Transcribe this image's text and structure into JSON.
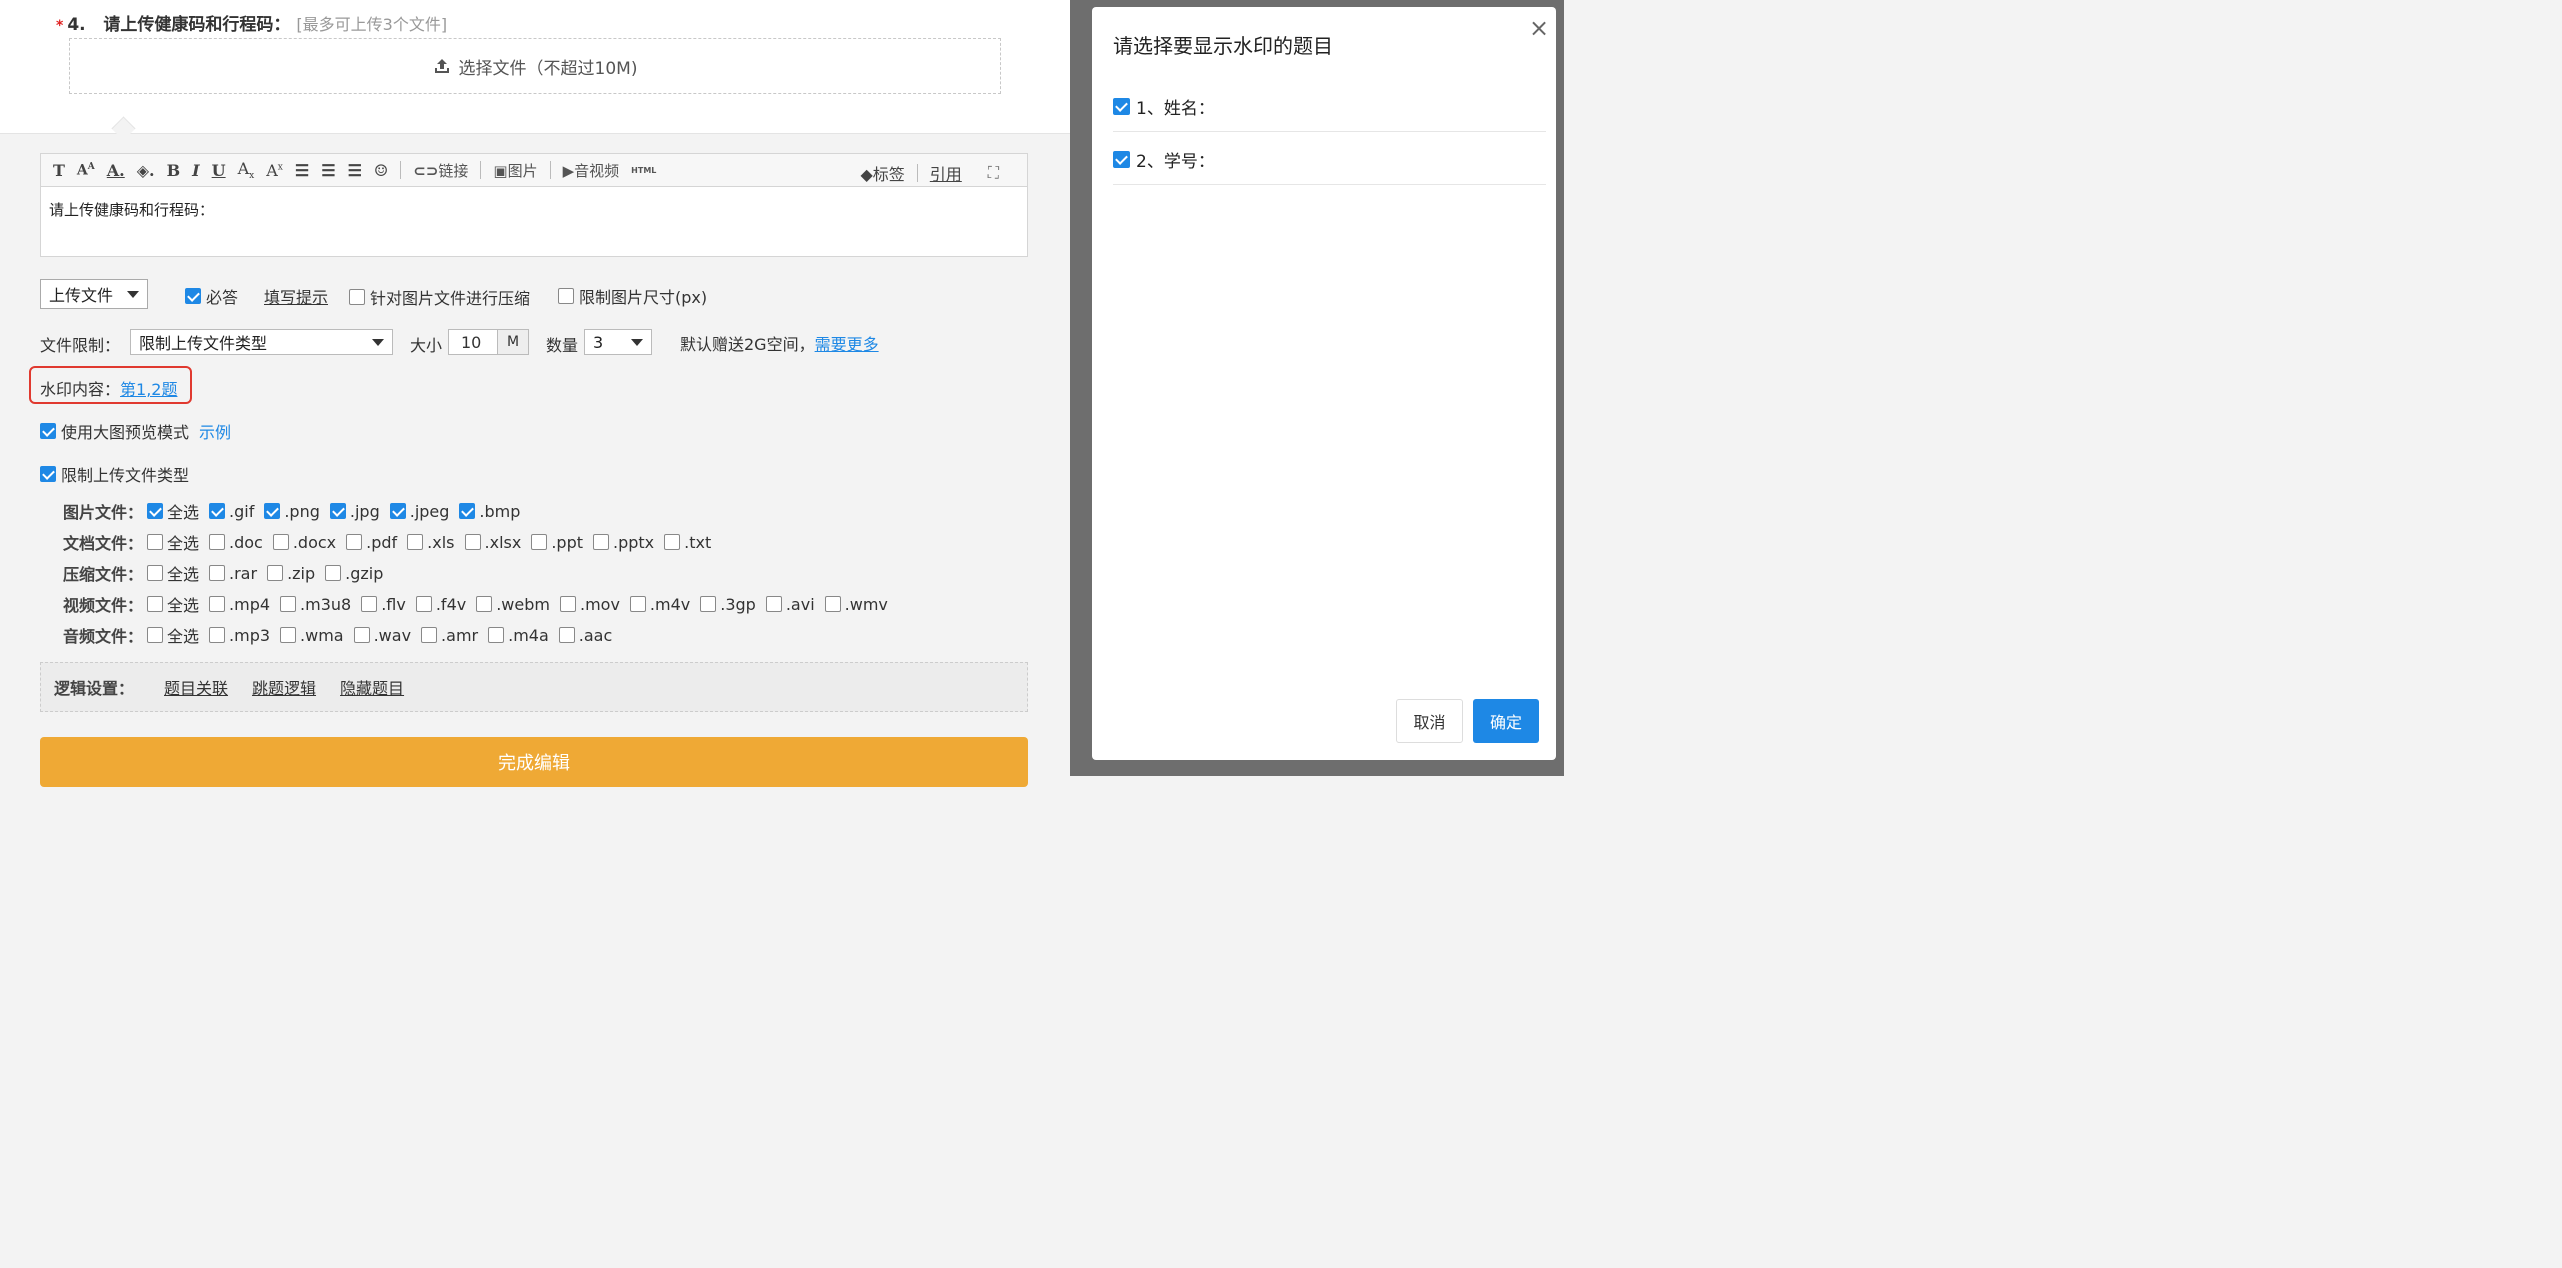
{
  "question": {
    "number": "4.",
    "title": "请上传健康码和行程码：",
    "hint": "[最多可上传3个文件]",
    "upload_label": "选择文件（不超过10M)"
  },
  "toolbar": {
    "link_label": "链接",
    "image_label": "图片",
    "av_label": "音视频",
    "html_label": "HTML",
    "tag_label": "标签",
    "quote_label": "引用"
  },
  "editor": {
    "content": "请上传健康码和行程码："
  },
  "settings": {
    "type_select": "上传文件",
    "required_label": "必答",
    "fill_hint_label": "填写提示",
    "compress_label": "针对图片文件进行压缩",
    "limit_size_label": "限制图片尺寸(px)",
    "file_limit_label": "文件限制：",
    "file_limit_select": "限制上传文件类型",
    "size_label": "大小",
    "size_value": "10",
    "size_unit": "M",
    "count_label": "数量",
    "count_value": "3",
    "free_space_text": "默认赠送2G空间，",
    "need_more_link": "需要更多",
    "watermark_label": "水印内容：",
    "watermark_value": "第1,2题",
    "preview_label": "使用大图预览模式",
    "example_link": "示例",
    "limit_type_label": "限制上传文件类型"
  },
  "file_types": [
    {
      "label": "图片文件：",
      "options": [
        {
          "text": "全选",
          "checked": true
        },
        {
          "text": ".gif",
          "checked": true
        },
        {
          "text": ".png",
          "checked": true
        },
        {
          "text": ".jpg",
          "checked": true
        },
        {
          "text": ".jpeg",
          "checked": true
        },
        {
          "text": ".bmp",
          "checked": true
        }
      ]
    },
    {
      "label": "文档文件：",
      "options": [
        {
          "text": "全选",
          "checked": false
        },
        {
          "text": ".doc",
          "checked": false
        },
        {
          "text": ".docx",
          "checked": false
        },
        {
          "text": ".pdf",
          "checked": false
        },
        {
          "text": ".xls",
          "checked": false
        },
        {
          "text": ".xlsx",
          "checked": false
        },
        {
          "text": ".ppt",
          "checked": false
        },
        {
          "text": ".pptx",
          "checked": false
        },
        {
          "text": ".txt",
          "checked": false
        }
      ]
    },
    {
      "label": "压缩文件：",
      "options": [
        {
          "text": "全选",
          "checked": false
        },
        {
          "text": ".rar",
          "checked": false
        },
        {
          "text": ".zip",
          "checked": false
        },
        {
          "text": ".gzip",
          "checked": false
        }
      ]
    },
    {
      "label": "视频文件：",
      "options": [
        {
          "text": "全选",
          "checked": false
        },
        {
          "text": ".mp4",
          "checked": false
        },
        {
          "text": ".m3u8",
          "checked": false
        },
        {
          "text": ".flv",
          "checked": false
        },
        {
          "text": ".f4v",
          "checked": false
        },
        {
          "text": ".webm",
          "checked": false
        },
        {
          "text": ".mov",
          "checked": false
        },
        {
          "text": ".m4v",
          "checked": false
        },
        {
          "text": ".3gp",
          "checked": false
        },
        {
          "text": ".avi",
          "checked": false
        },
        {
          "text": ".wmv",
          "checked": false
        }
      ]
    },
    {
      "label": "音频文件：",
      "options": [
        {
          "text": "全选",
          "checked": false
        },
        {
          "text": ".mp3",
          "checked": false
        },
        {
          "text": ".wma",
          "checked": false
        },
        {
          "text": ".wav",
          "checked": false
        },
        {
          "text": ".amr",
          "checked": false
        },
        {
          "text": ".m4a",
          "checked": false
        },
        {
          "text": ".aac",
          "checked": false
        }
      ]
    }
  ],
  "logic": {
    "label": "逻辑设置：",
    "links": [
      "题目关联",
      "跳题逻辑",
      "隐藏题目"
    ]
  },
  "finish_label": "完成编辑",
  "modal": {
    "title": "请选择要显示水印的题目",
    "close": "×",
    "items": [
      {
        "text": "1、姓名：",
        "checked": true
      },
      {
        "text": "2、学号：",
        "checked": true
      }
    ],
    "cancel_label": "取消",
    "confirm_label": "确定"
  },
  "colors": {
    "accent": "#1e88e5",
    "finish": "#efa935",
    "highlight": "#e0392f"
  }
}
